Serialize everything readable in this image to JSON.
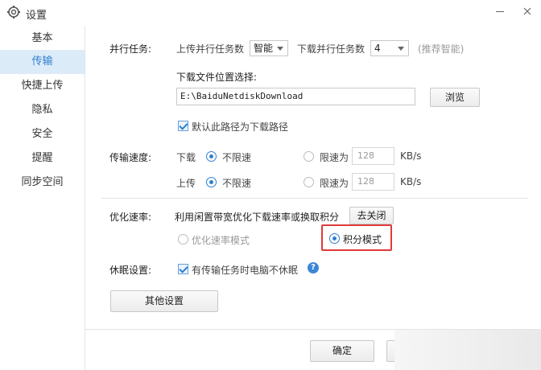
{
  "window": {
    "title": "设置"
  },
  "sidebar": {
    "items": [
      {
        "label": "基本",
        "active": false
      },
      {
        "label": "传输",
        "active": true
      },
      {
        "label": "快捷上传",
        "active": false
      },
      {
        "label": "隐私",
        "active": false
      },
      {
        "label": "安全",
        "active": false
      },
      {
        "label": "提醒",
        "active": false
      },
      {
        "label": "同步空间",
        "active": false
      }
    ]
  },
  "parallel": {
    "label": "并行任务:",
    "upload_label": "上传并行任务数",
    "upload_value": "智能",
    "download_label": "下载并行任务数",
    "download_value": "4",
    "hint": "(推荐智能)"
  },
  "download_location": {
    "label": "下载文件位置选择:",
    "path": "E:\\BaiduNetdiskDownload",
    "browse_label": "浏览",
    "default_checkbox_label": "默认此路径为下载路径",
    "default_checked": true
  },
  "speed": {
    "label": "传输速度:",
    "download_label": "下载",
    "upload_label": "上传",
    "unlimited_label": "不限速",
    "limit_label": "限速为",
    "download_limit_value": "128",
    "upload_limit_value": "128",
    "unit": "KB/s"
  },
  "optimize": {
    "label": "优化速率:",
    "description": "利用闲置带宽优化下载速率或换取积分",
    "close_button": "去关闭",
    "mode_speed_label": "优化速率模式",
    "mode_points_label": "积分模式",
    "selected": "积分模式"
  },
  "sleep": {
    "label": "休眠设置:",
    "checkbox_label": "有传输任务时电脑不休眠",
    "checked": true,
    "help_icon": "?"
  },
  "other_settings_label": "其他设置",
  "footer": {
    "ok_label": "确定"
  },
  "colors": {
    "accent": "#2f7fd0",
    "sidebar_active_bg": "#dcebf8",
    "highlight": "#e03a3a"
  }
}
